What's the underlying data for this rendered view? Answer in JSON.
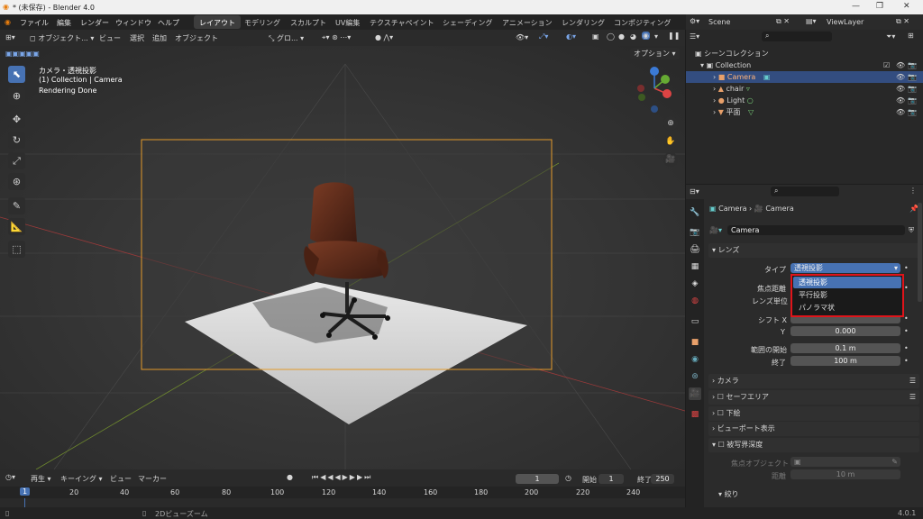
{
  "window": {
    "title": "* (未保存) - Blender 4.0"
  },
  "menu": [
    "ファイル",
    "編集",
    "レンダー",
    "ウィンドウ",
    "ヘルプ"
  ],
  "workspaces": [
    "レイアウト",
    "モデリング",
    "スカルプト",
    "UV編集",
    "テクスチャペイント",
    "シェーディング",
    "アニメーション",
    "レンダリング",
    "コンポジティング"
  ],
  "scene": {
    "label": "Scene",
    "viewlayer": "ViewLayer"
  },
  "viewport_header": {
    "mode": "オブジェクト...",
    "view": "ビュー",
    "select": "選択",
    "add": "追加",
    "object": "オブジェクト",
    "transform": "グロ...",
    "options": "オプション"
  },
  "viewport_info": {
    "line1": "カメラ・透視投影",
    "line2": "(1) Collection | Camera",
    "line3": "Rendering Done"
  },
  "outliner": {
    "scene_collection": "シーンコレクション",
    "collection": "Collection",
    "items": [
      {
        "name": "Camera",
        "selected": true
      },
      {
        "name": "chair",
        "selected": false
      },
      {
        "name": "Light",
        "selected": false
      },
      {
        "name": "平面",
        "selected": false
      }
    ]
  },
  "props": {
    "crumb1": "Camera",
    "crumb2": "Camera",
    "data_name": "Camera",
    "lens_section": "レンズ",
    "type_label": "タイプ",
    "type_value": "透視投影",
    "focal_label": "焦点距離",
    "lens_unit_label": "レンズ単位",
    "shift_label": "シフト X",
    "shift_y_label": "Y",
    "shift_y_value": "0.000",
    "clip_start_label": "範囲の開始",
    "clip_start_value": "0.1 m",
    "clip_end_label": "終了",
    "clip_end_value": "100 m",
    "sections": [
      "カメラ",
      "セーフエリア",
      "下絵",
      "ビューポート表示"
    ],
    "dof_section": "被写界深度",
    "focus_object_label": "焦点オブジェクト",
    "distance_label": "距離",
    "distance_value": "10 m",
    "aperture_section": "絞り"
  },
  "dropdown": {
    "options": [
      "透視投影",
      "平行投影",
      "パノラマ状"
    ],
    "selected": 0
  },
  "timeline": {
    "playback": "再生",
    "keying": "キーイング",
    "view": "ビュー",
    "marker": "マーカー",
    "current_frame": "1",
    "start_label": "開始",
    "start": "1",
    "end_label": "終了",
    "end": "250",
    "ticks": [
      "1",
      "20",
      "40",
      "60",
      "80",
      "100",
      "120",
      "140",
      "160",
      "180",
      "200",
      "220",
      "240"
    ]
  },
  "status": {
    "hint": "2Dビューズーム",
    "version": "4.0.1"
  }
}
